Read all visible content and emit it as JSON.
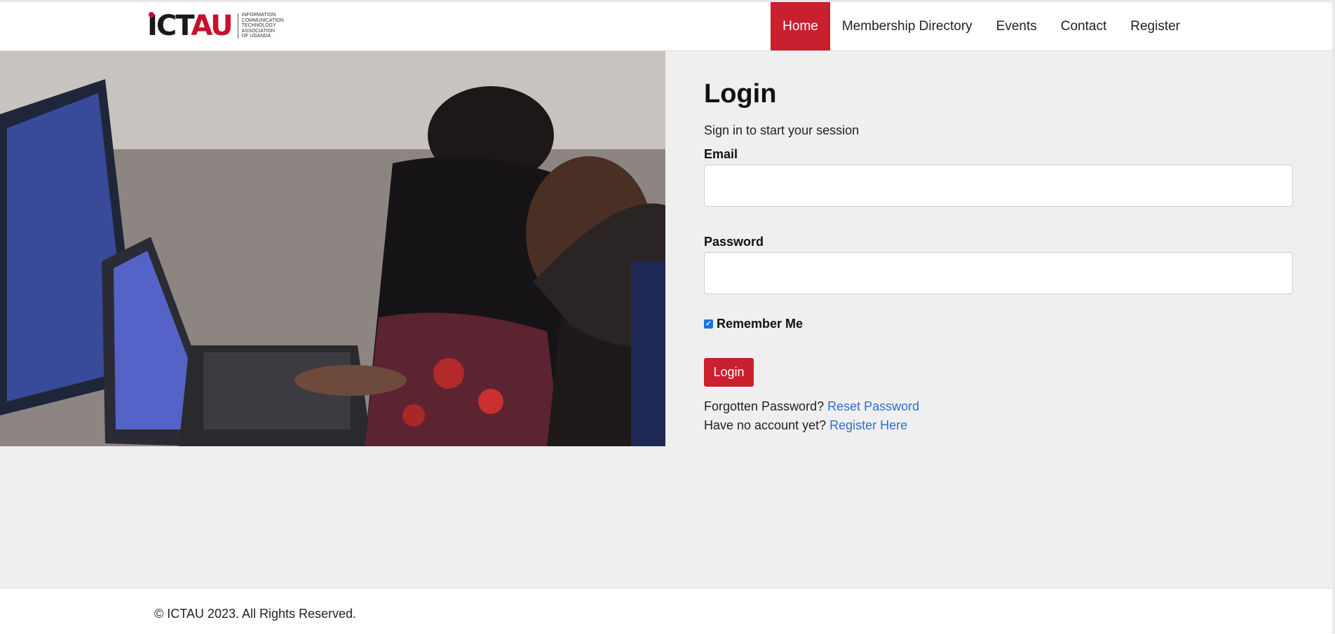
{
  "brand": {
    "logo_mark_main": "ICT",
    "logo_mark_accent": "AU",
    "logo_text": [
      "INFORMATION",
      "COMMUNICATION",
      "TECHNOLOGY",
      "ASSOCIATION",
      "OF UGANDA"
    ]
  },
  "nav": {
    "items": [
      {
        "label": "Home",
        "active": true
      },
      {
        "label": "Membership Directory",
        "active": false
      },
      {
        "label": "Events",
        "active": false
      },
      {
        "label": "Contact",
        "active": false
      },
      {
        "label": "Register",
        "active": false
      }
    ]
  },
  "login": {
    "title": "Login",
    "subtitle": "Sign in to start your session",
    "email_label": "Email",
    "email_value": "",
    "password_label": "Password",
    "password_value": "",
    "remember_label": "Remember Me",
    "remember_checked": true,
    "submit_label": "Login",
    "forgot_text": "Forgotten Password?",
    "reset_link": "Reset Password",
    "no_account_text": "Have no account yet?",
    "register_link": "Register Here"
  },
  "footer": {
    "copyright": "© ICTAU 2023. All Rights Reserved."
  },
  "colors": {
    "accent": "#c8202e",
    "link": "#2e6fcf",
    "main_bg": "#efefef"
  }
}
